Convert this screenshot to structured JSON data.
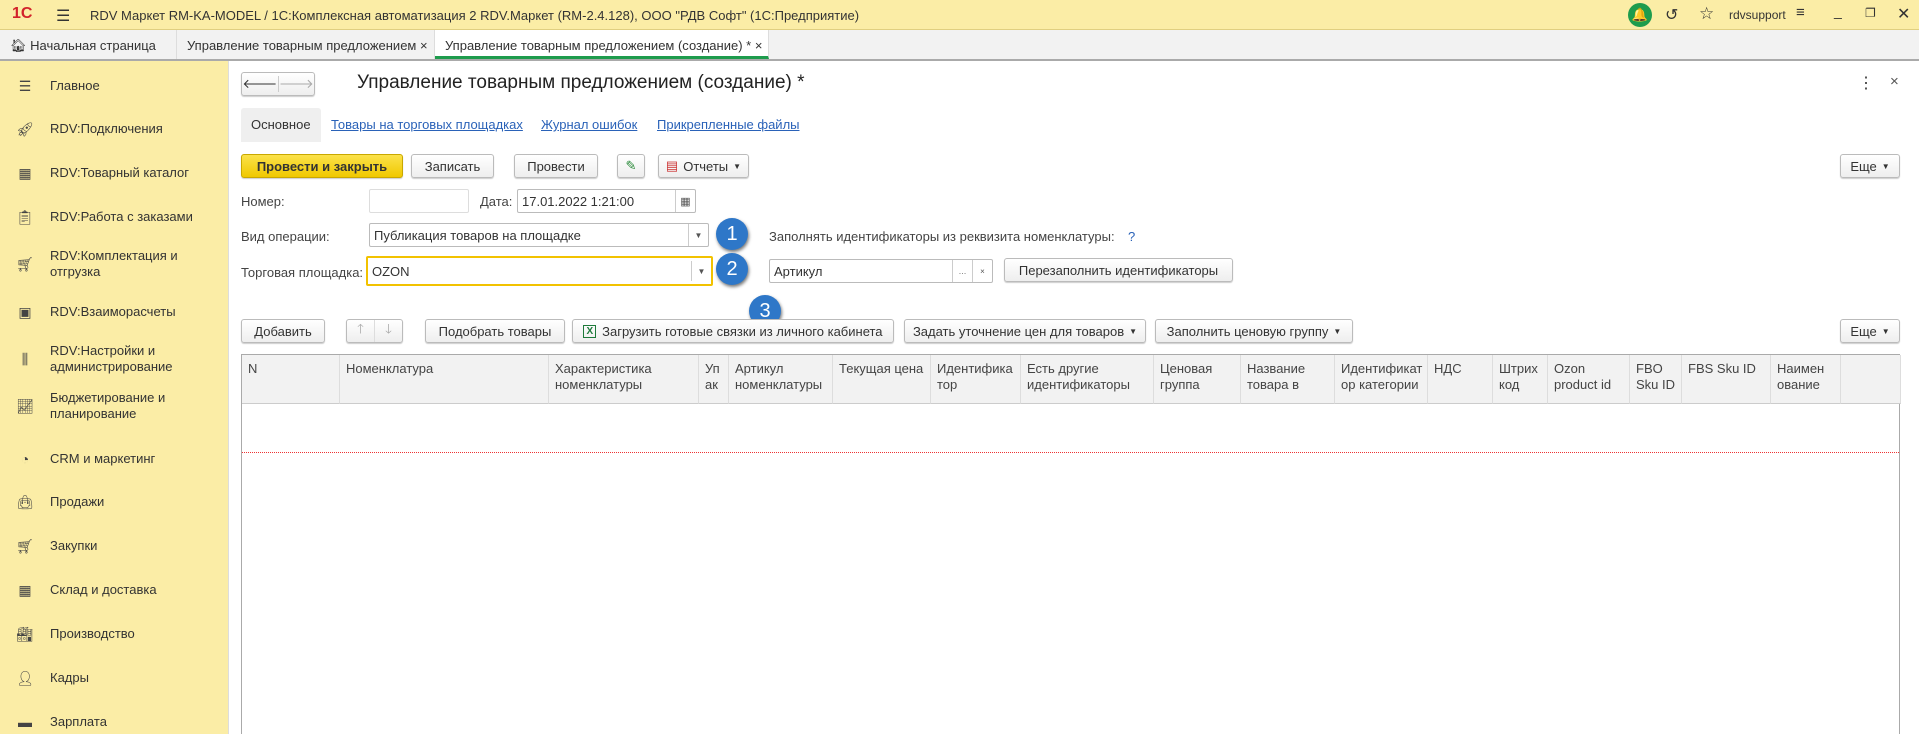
{
  "window": {
    "title": "RDV Маркет RM-KA-MODEL / 1С:Комплексная автоматизация 2 RDV.Маркет (RM-2.4.128), ООО \"РДВ Софт\"  (1С:Предприятие)",
    "logo": "1С",
    "user": "rdvsupport"
  },
  "tabs": [
    {
      "label": "Начальная страница"
    },
    {
      "label": "Управление товарным предложением"
    },
    {
      "label": "Управление товарным предложением (создание) *"
    }
  ],
  "sidebar": {
    "items": [
      {
        "label": "Главное",
        "icon": "menu-icon"
      },
      {
        "label": "RDV:Подключения",
        "icon": "rocket-icon"
      },
      {
        "label": "RDV:Товарный каталог",
        "icon": "grid-icon"
      },
      {
        "label": "RDV:Работа с заказами",
        "icon": "clipboard-icon"
      },
      {
        "label": "RDV:Комплектация и отгрузка",
        "icon": "cart-icon"
      },
      {
        "label": "RDV:Взаиморасчеты",
        "icon": "calculator-icon"
      },
      {
        "label": "RDV:Настройки и администрирование",
        "icon": "sliders-icon"
      },
      {
        "label": "Бюджетирование и планирование",
        "icon": "chart-icon"
      },
      {
        "label": "CRM и маркетинг",
        "icon": "pie-icon"
      },
      {
        "label": "Продажи",
        "icon": "bag-icon"
      },
      {
        "label": "Закупки",
        "icon": "basket-icon"
      },
      {
        "label": "Склад и доставка",
        "icon": "warehouse-icon"
      },
      {
        "label": "Производство",
        "icon": "factory-icon"
      },
      {
        "label": "Кадры",
        "icon": "person-icon"
      },
      {
        "label": "Зарплата",
        "icon": "wallet-icon"
      }
    ]
  },
  "form": {
    "title": "Управление товарным предложением (создание) *",
    "subtabs": [
      "Основное",
      "Товары на торговых площадках",
      "Журнал ошибок",
      "Прикрепленные файлы"
    ],
    "toolbar": {
      "post_close": "Провести и закрыть",
      "save": "Записать",
      "post": "Провести",
      "reports": "Отчеты",
      "more": "Еще"
    },
    "number_label": "Номер:",
    "number_value": "",
    "date_label": "Дата:",
    "date_value": "17.01.2022  1:21:00",
    "operation_label": "Вид операции:",
    "operation_value": "Публикация товаров на площадке",
    "marketplace_label": "Торговая площадка:",
    "marketplace_value": "OZON",
    "fill_ids_label": "Заполнять идентификаторы из реквизита номенклатуры:",
    "help": "?",
    "attribute_value": "Артикул",
    "refill_button": "Перезаполнить идентификаторы",
    "badges": [
      "1",
      "2",
      "3"
    ]
  },
  "table_toolbar": {
    "add": "Добавить",
    "pick": "Подобрать товары",
    "load": "Загрузить готовые связки из личного кабинета",
    "price_refine": "Задать уточнение цен для товаров",
    "price_group": "Заполнить ценовую группу",
    "more": "Еще"
  },
  "table": {
    "columns": [
      "N",
      "Номенклатура",
      "Характеристика номенклатуры",
      "Уп ак",
      "Артикул номенклатуры",
      "Текущая цена",
      "Идентифика тор",
      "Есть другие идентификаторы",
      "Ценовая группа",
      "Название товара в",
      "Идентификат ор категории",
      "НДС",
      "Штрих код",
      "Ozon product id",
      "FBO Sku ID",
      "FBS Sku ID",
      "Наимен ование",
      ""
    ],
    "rows": []
  }
}
